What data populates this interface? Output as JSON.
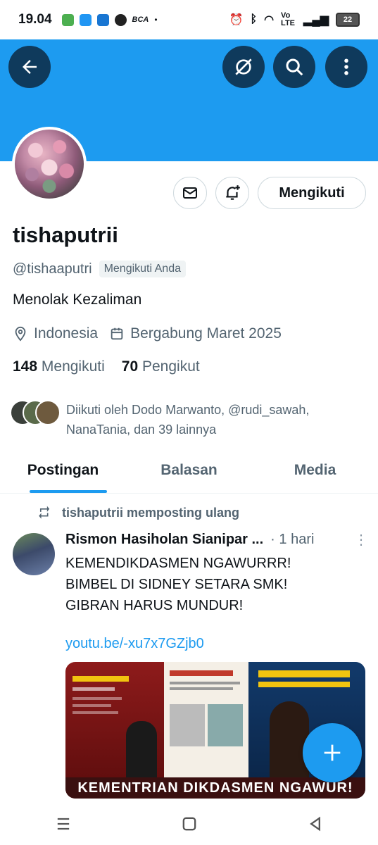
{
  "status_bar": {
    "time": "19.04",
    "net_label": "Vo LTE",
    "battery": "22"
  },
  "profile": {
    "name": "tishaputrii",
    "handle": "@tishaaputri",
    "follows_you": "Mengikuti Anda",
    "bio": "Menolak Kezaliman",
    "location": "Indonesia",
    "joined": "Bergabung Maret 2025",
    "following_count": "148",
    "following_label": "Mengikuti",
    "followers_count": "70",
    "followers_label": "Pengikut",
    "followed_by": "Diikuti oleh Dodo Marwanto, @rudi_sawah, NanaTania, dan 39 lainnya",
    "follow_button": "Mengikuti"
  },
  "tabs": [
    "Postingan",
    "Balasan",
    "Media"
  ],
  "post": {
    "repost_label": "tishaputrii memposting ulang",
    "author": "Rismon Hasiholan Sianipar ...",
    "time": "· 1 hari",
    "text": "KEMENDIKDASMEN NGAWURRR!\nBIMBEL DI SIDNEY SETARA SMK!\nGIBRAN HARUS MUNDUR!",
    "link": "youtu.be/-xu7x7GZjb0",
    "media_caption": "KEMENTRIAN DIKDASMEN NGAWUR!"
  },
  "colors": {
    "accent": "#1d9bf0",
    "banner": "#1d9bf0",
    "text_secondary": "#536471"
  }
}
